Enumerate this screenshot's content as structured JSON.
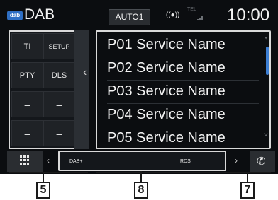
{
  "header": {
    "logo_text": "dab",
    "source": "DAB",
    "auto_button": "AUTO1",
    "signal_icon": "((●))",
    "tel_label": "TEL",
    "clock": "10:00"
  },
  "left_panel": {
    "buttons": [
      {
        "label": "TI"
      },
      {
        "label": "SETUP"
      },
      {
        "label": "PTY"
      },
      {
        "label": "DLS"
      },
      {
        "label": "–"
      },
      {
        "label": "–"
      },
      {
        "label": "–"
      },
      {
        "label": "–"
      }
    ]
  },
  "list": {
    "items": [
      {
        "label": "P01 Service Name"
      },
      {
        "label": "P02 Service Name"
      },
      {
        "label": "P03 Service Name"
      },
      {
        "label": "P04 Service Name"
      },
      {
        "label": "P05 Service Name"
      }
    ]
  },
  "bottom": {
    "dab_plus": "DAB+",
    "rds": "RDS"
  },
  "callouts": {
    "left": "5",
    "center": "8",
    "right": "7"
  },
  "colors": {
    "background": "#0b0d10",
    "accent": "#3d7fd4",
    "frame": "#d9d9d9"
  }
}
